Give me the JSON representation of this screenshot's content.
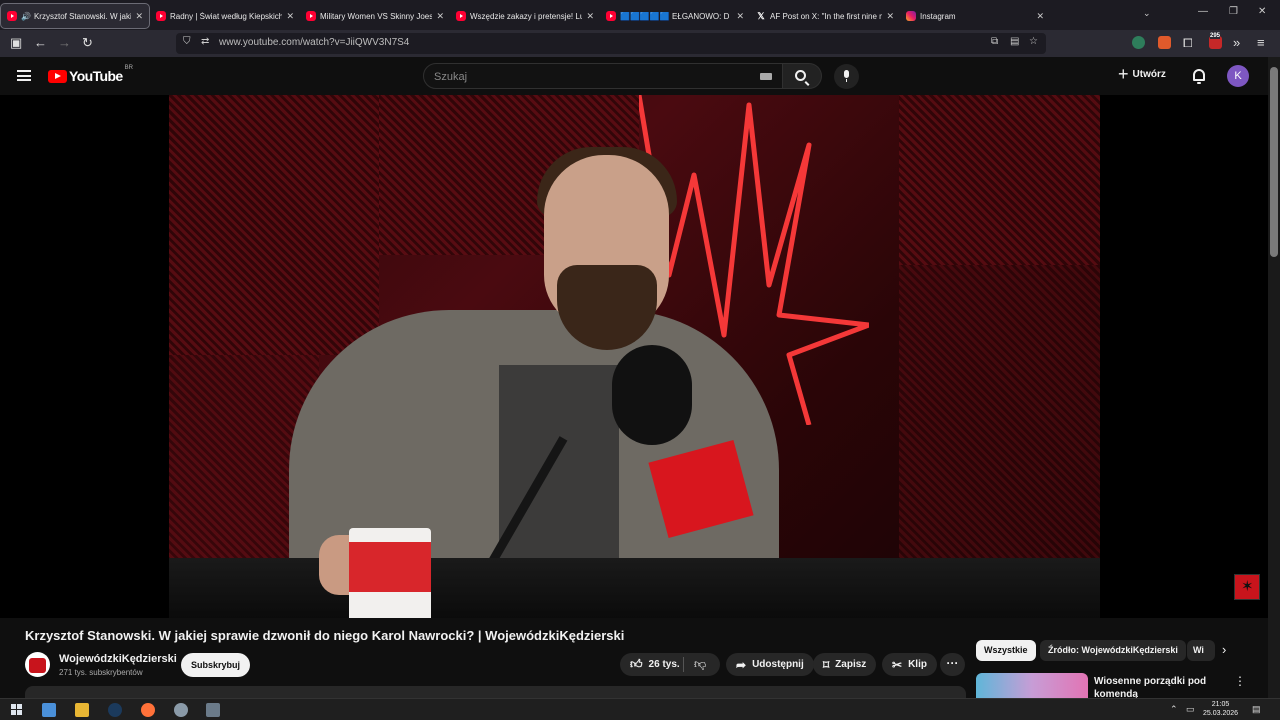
{
  "browser": {
    "tabs": [
      {
        "title": "Krzysztof Stanowski. W jakiej",
        "favicon": "youtube-icon",
        "active": true,
        "sound": true
      },
      {
        "title": "Radny | Świat według Kiepskich",
        "favicon": "youtube-icon"
      },
      {
        "title": "Military Women VS Skinny Joes",
        "favicon": "youtube-icon"
      },
      {
        "title": "Wszędzie zakazy i pretensje! Lu",
        "favicon": "youtube-icon"
      },
      {
        "title": "🟦🟦🟦🟦🟦 EŁGANOWO: D",
        "favicon": "youtube-icon"
      },
      {
        "title": "AF Post on X: \"In the first nine m",
        "favicon": "x-icon"
      },
      {
        "title": "Instagram",
        "favicon": "instagram-icon"
      }
    ],
    "url": "www.youtube.com/watch?v=JiiQWV3N7S4",
    "extension_badge": "295"
  },
  "youtube": {
    "logo_text": "YouTube",
    "country_code": "BR",
    "search_placeholder": "Szukaj",
    "create_label": "Utwórz",
    "avatar_letter": "K"
  },
  "video": {
    "title": "Krzysztof Stanowski. W jakiej sprawie dzwonił do niego Karol Nawrocki? | WojewódzkiKędzierski",
    "channel_name": "WojewódzkiKędzierski",
    "subscribers": "271 tys. subskrybentów",
    "subscribe_label": "Subskrybuj",
    "likes": "26 tys.",
    "share_label": "Udostępnij",
    "save_label": "Zapisz",
    "clip_label": "Klip"
  },
  "sidebar": {
    "chips": [
      "Wszystkie",
      "Źródło: WojewódzkiKędzierski",
      "Wi"
    ],
    "recommendation_title": "Wiosenne porządki pod komendą"
  },
  "taskbar": {
    "time": "21:05",
    "date": "25.03.2026"
  },
  "colors": {
    "youtube_red": "#ff0000",
    "background": "#0f0f0f",
    "avatar": "#7e57c2"
  }
}
